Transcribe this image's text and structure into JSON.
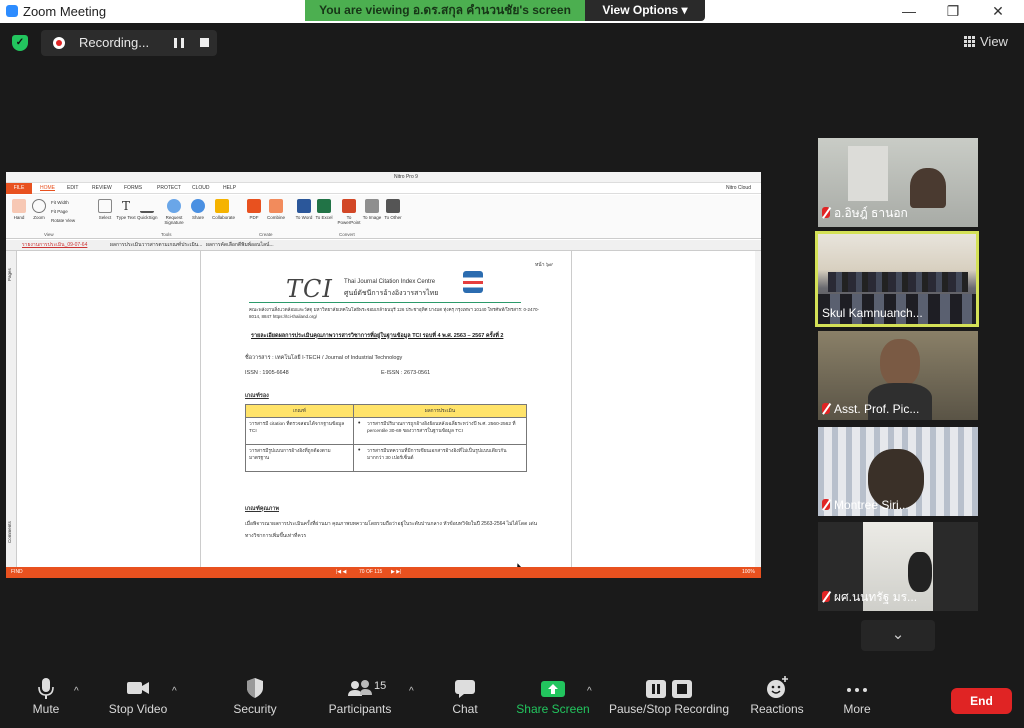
{
  "window": {
    "title": "Zoom Meeting",
    "minimize": "—",
    "maximize": "❐",
    "close": "✕"
  },
  "banner": {
    "viewing_text": "You are viewing อ.ดร.สกุล  คำนวนชัย's screen",
    "view_options": "View Options ▾"
  },
  "recording": {
    "label": "Recording..."
  },
  "view_button": "View",
  "nitro": {
    "title": "Nitro Pro 9",
    "cloud": "Nitro Cloud",
    "tabs": [
      "FILE",
      "HOME",
      "EDIT",
      "REVIEW",
      "FORMS",
      "PROTECT",
      "CLOUD",
      "HELP"
    ],
    "ribbon_buttons": [
      "Hand",
      "Zoom",
      "Select",
      "Type Text",
      "QuickSign",
      "Request Signature",
      "Share",
      "Collaborate",
      "PDF",
      "Combine",
      "To Word",
      "To Excel",
      "To PowerPoint",
      "To Image",
      "To Other"
    ],
    "fit_options": [
      "Fit Width",
      "Fit Page",
      "Rotate View"
    ],
    "groups": [
      "View",
      "Tools",
      "Create",
      "Convert"
    ],
    "doc_tabs": [
      "รายงานการประเมิน_09-07-64",
      "ผลการประเมินวารสารตามเกณฑ์ประเมิน...",
      "ผลการคัดเลือกตีพิมพ์ออนไลน์..."
    ],
    "left_panel": [
      "Pages",
      "Comments"
    ],
    "status": {
      "mode": "FIND",
      "page": "70 OF 115",
      "zoom": "100%"
    }
  },
  "document": {
    "page_number": "หน้า ๖๙",
    "logo": "TCI",
    "logo_en": "Thai Journal Citation Index Centre",
    "logo_th": "ศูนย์ดัชนีการอ้างอิงวารสารไทย",
    "address": "คณะพลังงานสิ่งแวดล้อมและวัสดุ มหาวิทยาลัยเทคโนโลยีพระจอมเกล้าธนบุรี 126 ประชาอุทิศ บางมด ทุ่งครุ กรุงเทพฯ 10140  โทรศัพท์/โทรสาร: 0-2470-8014, 8847  https://tci-thailand.org/",
    "heading": "รายละเอียดผลการประเมินคุณภาพวารสารวิชาการที่อยู่ในฐานข้อมูล TCI รอบที่ 4 พ.ศ. 2563 – 2567 ครั้งที่ 2",
    "journal": "ชื่อวารสาร : เทคโนโลยี I-TECH / Journal of Industrial Technology",
    "issn": "ISSN : 1905-6648",
    "eissn": "E-ISSN : 2673-0561",
    "criteria_title": "เกณฑ์รอง",
    "table_headers": [
      "เกณฑ์",
      "ผลการประเมิน"
    ],
    "table_rows": [
      [
        "วารสารมี citation ที่ตรวจสอบได้จากฐานข้อมูล TCI",
        "วารสารมีปริมาณการถูกอ้างอิงย้อนหลังเฉลี่ยระหว่างปี พ.ศ. 2560-2562 ที่ percentile 30-69 ของวารสารในฐานข้อมูล TCI"
      ],
      [
        "วารสารมีรูปแบบการอ้างอิงที่ถูกต้องตามมาตรฐาน",
        "วารสารมีบทความที่มีการเขียนเอกสารอ้างอิงที่ไม่เป็นรูปแบบเดียวกันมากกว่า 30 เปอร์เซ็นต์"
      ]
    ],
    "quality_title": "เกณฑ์คุณภาพ",
    "paragraph": "เมื่อพิจารณาผลการประเมินครั้งที่ผ่านมา คุณภาพบทความโดยรวมถือว่าอยู่ในระดับปานกลาง หัวข้อบทวิจัยในปี 2563-2564 ไม่ได้โดด เด่นทางวิชาการเพิ่มขึ้นเท่าที่ควร"
  },
  "participants": [
    {
      "name": "อ.อิษฎ์ ธานอก",
      "muted": true
    },
    {
      "name": "Skul Kamnuanch...",
      "muted": false,
      "active_speaker": true
    },
    {
      "name": "Asst. Prof. Pic...",
      "muted": true
    },
    {
      "name": "Montree Siri...",
      "muted": true
    },
    {
      "name": "ผศ.นนทรัฐ มร...",
      "muted": true
    }
  ],
  "toolbar": {
    "mute": "Mute",
    "stop_video": "Stop Video",
    "security": "Security",
    "participants": "Participants",
    "participants_count": "15",
    "chat": "Chat",
    "share_screen": "Share Screen",
    "pause_stop_recording": "Pause/Stop Recording",
    "reactions": "Reactions",
    "more": "More",
    "end": "End"
  },
  "colors": {
    "share_green": "#22c55e",
    "end_red": "#e02424",
    "active_border": "#d4e157",
    "nitro_orange": "#e8511f"
  }
}
